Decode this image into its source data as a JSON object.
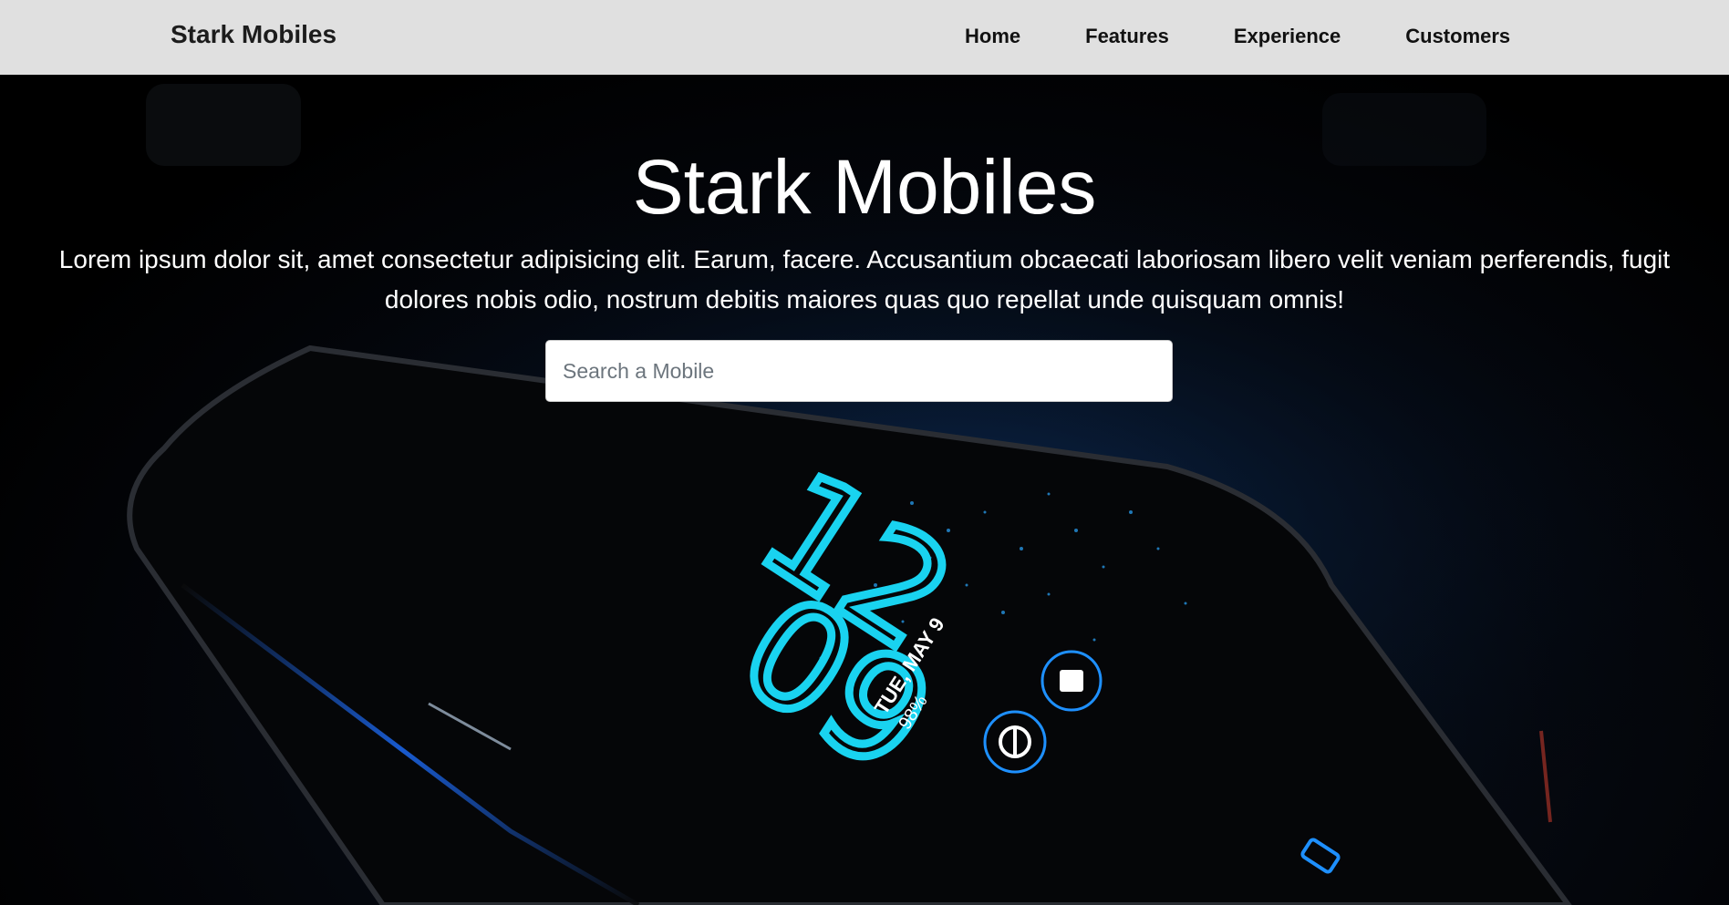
{
  "navbar": {
    "brand": "Stark Mobiles",
    "links": [
      "Home",
      "Features",
      "Experience",
      "Customers"
    ]
  },
  "hero": {
    "title": "Stark Mobiles",
    "description": "Lorem ipsum dolor sit, amet consectetur adipisicing elit. Earum, facere. Accusantium obcaecati laboriosam libero velit veniam perferendis, fugit dolores nobis odio, nostrum debitis maiores quas quo repellat unde quisquam omnis!",
    "search_placeholder": "Search a Mobile",
    "search_value": "",
    "background_image": {
      "clock_hours": "12",
      "clock_minutes": "09",
      "date_text": "TUE, MAY 9",
      "battery_text": "98%",
      "accent_color": "#19d3f0"
    }
  },
  "colors": {
    "navbar_bg": "#e0e0e0",
    "hero_text": "#ffffff",
    "clock_cyan": "#19d3f0",
    "glow_blue": "#1e90ff"
  }
}
